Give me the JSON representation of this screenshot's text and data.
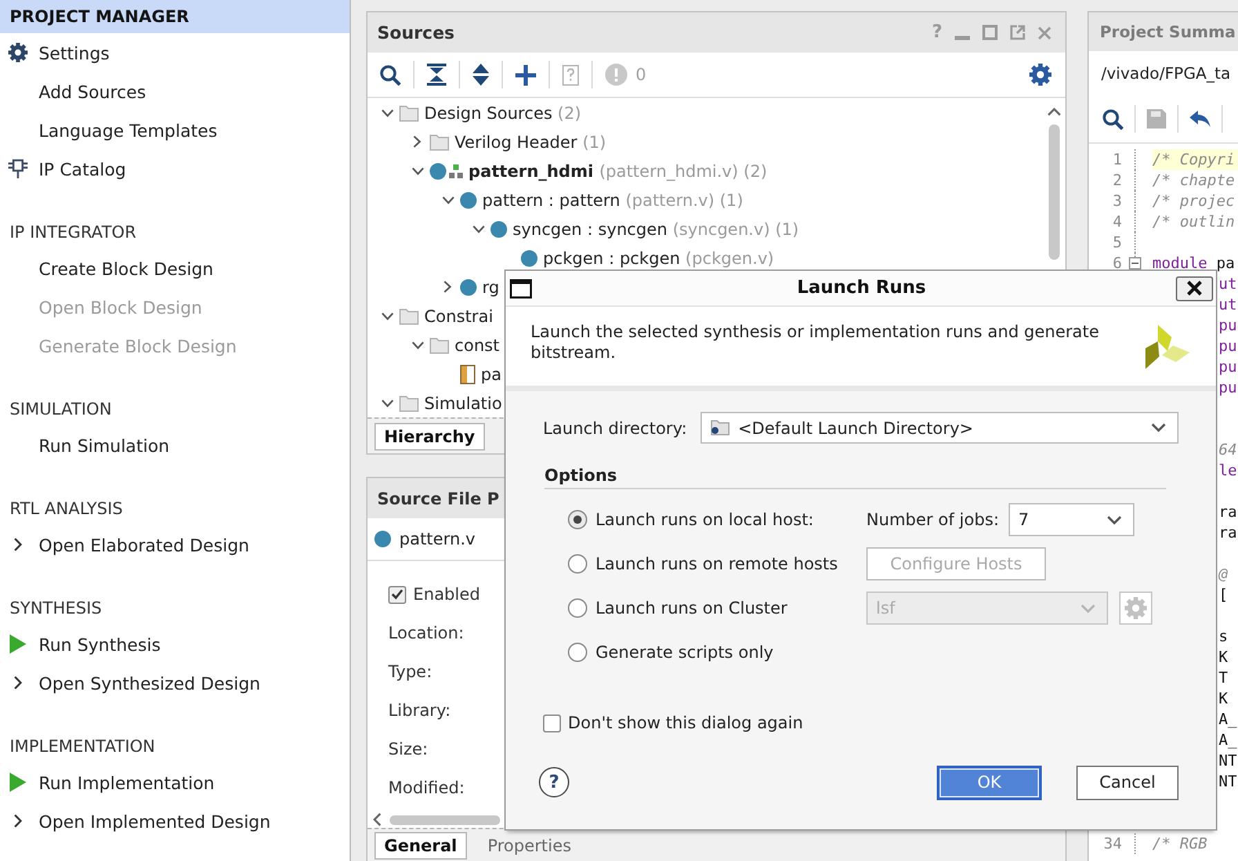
{
  "flow_navigator": {
    "sections": [
      {
        "title": "PROJECT MANAGER",
        "selected": true,
        "items": [
          {
            "label": "Settings",
            "kind": "gear",
            "disabled": false
          },
          {
            "label": "Add Sources",
            "kind": "plain",
            "disabled": false
          },
          {
            "label": "Language Templates",
            "kind": "plain",
            "disabled": false
          },
          {
            "label": "IP Catalog",
            "kind": "chip",
            "disabled": false
          }
        ]
      },
      {
        "title": "IP INTEGRATOR",
        "selected": false,
        "items": [
          {
            "label": "Create Block Design",
            "kind": "plain",
            "disabled": false
          },
          {
            "label": "Open Block Design",
            "kind": "plain",
            "disabled": true
          },
          {
            "label": "Generate Block Design",
            "kind": "plain",
            "disabled": true
          }
        ]
      },
      {
        "title": "SIMULATION",
        "selected": false,
        "items": [
          {
            "label": "Run Simulation",
            "kind": "plain",
            "disabled": false
          }
        ]
      },
      {
        "title": "RTL ANALYSIS",
        "selected": false,
        "items": [
          {
            "label": "Open Elaborated Design",
            "kind": "expand",
            "disabled": false
          }
        ]
      },
      {
        "title": "SYNTHESIS",
        "selected": false,
        "items": [
          {
            "label": "Run Synthesis",
            "kind": "run",
            "disabled": false
          },
          {
            "label": "Open Synthesized Design",
            "kind": "expand",
            "disabled": false
          }
        ]
      },
      {
        "title": "IMPLEMENTATION",
        "selected": false,
        "items": [
          {
            "label": "Run Implementation",
            "kind": "run",
            "disabled": false
          },
          {
            "label": "Open Implemented Design",
            "kind": "expand",
            "disabled": false
          }
        ]
      }
    ]
  },
  "sources": {
    "title": "Sources",
    "help": "?",
    "message_count": "0",
    "tree": [
      {
        "label": "Design Sources",
        "detail": "(2)",
        "kind": "folder",
        "expanded": true,
        "children": [
          {
            "label": "Verilog Header",
            "detail": "(1)",
            "kind": "folder",
            "expanded": false
          },
          {
            "label": "pattern_hdmi",
            "detail": "(pattern_hdmi.v) (2)",
            "kind": "top_module",
            "expanded": true,
            "children": [
              {
                "label": "pattern : pattern",
                "detail": "(pattern.v) (1)",
                "kind": "module",
                "expanded": true,
                "children": [
                  {
                    "label": "syncgen : syncgen",
                    "detail": "(syncgen.v) (1)",
                    "kind": "module",
                    "expanded": true,
                    "children": [
                      {
                        "label": "pckgen : pckgen",
                        "detail": "(pckgen.v)",
                        "kind": "module"
                      }
                    ]
                  }
                ]
              },
              {
                "label": "rg",
                "kind": "module",
                "expanded": false
              }
            ]
          }
        ]
      },
      {
        "label": "Constrai",
        "kind": "folder",
        "expanded": true,
        "children": [
          {
            "label": "const",
            "kind": "folder",
            "expanded": true,
            "children": [
              {
                "label": "pa",
                "kind": "constraint_file"
              }
            ]
          }
        ]
      },
      {
        "label": "Simulatio",
        "kind": "folder",
        "expanded": true
      }
    ],
    "tabs": [
      {
        "label": "Hierarchy",
        "selected": true
      }
    ]
  },
  "source_file_properties": {
    "title": "Source File P",
    "file": "pattern.v",
    "enabled": {
      "label": "Enabled",
      "checked": true
    },
    "fields": [
      "Location:",
      "Type:",
      "Library:",
      "Size:",
      "Modified:"
    ],
    "tabs": [
      {
        "label": "General",
        "selected": true
      },
      {
        "label": "Properties",
        "selected": false
      }
    ]
  },
  "project_summary": {
    "title": "Project Summa",
    "path": "/vivado/FPGA_ta",
    "lines": [
      {
        "kind": "numbered",
        "number": "1",
        "current": true,
        "fold": false,
        "code": [
          {
            "text": "/* Copyri",
            "kind": "comment"
          }
        ]
      },
      {
        "kind": "numbered",
        "number": "2",
        "current": false,
        "fold": false,
        "code": [
          {
            "text": "/* chapte",
            "kind": "comment"
          }
        ]
      },
      {
        "kind": "numbered",
        "number": "3",
        "current": false,
        "fold": false,
        "code": [
          {
            "text": "/* projec",
            "kind": "comment"
          }
        ]
      },
      {
        "kind": "numbered",
        "number": "4",
        "current": false,
        "fold": false,
        "code": [
          {
            "text": "/* outlin",
            "kind": "comment"
          }
        ]
      },
      {
        "kind": "numbered",
        "number": "5",
        "current": false,
        "fold": false
      },
      {
        "kind": "numbered",
        "number": "6",
        "current": false,
        "fold": true,
        "code": [
          {
            "text": "module",
            "kind": "keyword"
          },
          {
            "text": "pa",
            "kind": "plain"
          }
        ]
      },
      {
        "kind": "tail",
        "code": [
          {
            "text": "ut",
            "kind": "keyword"
          }
        ]
      },
      {
        "kind": "tail",
        "code": [
          {
            "text": "ut",
            "kind": "keyword"
          }
        ]
      },
      {
        "kind": "tail",
        "code": [
          {
            "text": "pu",
            "kind": "keyword"
          }
        ]
      },
      {
        "kind": "tail",
        "code": [
          {
            "text": "pu",
            "kind": "keyword"
          }
        ]
      },
      {
        "kind": "tail",
        "code": [
          {
            "text": "pu",
            "kind": "keyword"
          }
        ]
      },
      {
        "kind": "tail",
        "code": [
          {
            "text": "pu",
            "kind": "keyword"
          }
        ]
      },
      {
        "kind": "blank"
      },
      {
        "kind": "blank"
      },
      {
        "kind": "tail",
        "code": [
          {
            "text": "64",
            "kind": "comment"
          }
        ]
      },
      {
        "kind": "tail",
        "code": [
          {
            "text": "le",
            "kind": "keyword"
          }
        ]
      },
      {
        "kind": "blank"
      },
      {
        "kind": "tail",
        "code": [
          {
            "text": "ra",
            "kind": "plain"
          }
        ]
      },
      {
        "kind": "tail",
        "code": [
          {
            "text": "ra",
            "kind": "plain"
          }
        ]
      },
      {
        "kind": "blank"
      },
      {
        "kind": "tail",
        "code": [
          {
            "text": "@",
            "kind": "comment"
          }
        ]
      },
      {
        "kind": "tail",
        "code": [
          {
            "text": "[",
            "kind": "plain"
          }
        ]
      },
      {
        "kind": "blank"
      },
      {
        "kind": "tail",
        "code": [
          {
            "text": "s",
            "kind": "plain"
          }
        ]
      },
      {
        "kind": "tail",
        "code": [
          {
            "text": "K",
            "kind": "plain"
          }
        ]
      },
      {
        "kind": "tail",
        "code": [
          {
            "text": "T",
            "kind": "plain"
          }
        ]
      },
      {
        "kind": "tail",
        "code": [
          {
            "text": "K",
            "kind": "plain"
          }
        ]
      },
      {
        "kind": "tail",
        "code": [
          {
            "text": "A_",
            "kind": "plain"
          }
        ]
      },
      {
        "kind": "tail",
        "code": [
          {
            "text": "A_",
            "kind": "plain"
          }
        ]
      },
      {
        "kind": "tail",
        "code": [
          {
            "text": "NT",
            "kind": "plain"
          }
        ]
      },
      {
        "kind": "tail",
        "code": [
          {
            "text": "NT",
            "kind": "plain"
          }
        ]
      },
      {
        "kind": "blank"
      },
      {
        "kind": "blank"
      },
      {
        "kind": "numbered",
        "number": "34",
        "current": false,
        "fold": false,
        "code": [
          {
            "text": "/* RGB",
            "kind": "comment"
          }
        ]
      }
    ]
  },
  "dialog": {
    "title": "Launch Runs",
    "description": "Launch the selected synthesis or implementation runs and generate bitstream.",
    "launch_directory": {
      "label": "Launch directory:",
      "value": "<Default Launch Directory>"
    },
    "options": {
      "title": "Options",
      "choices": [
        {
          "kind": "jobs",
          "label": "Launch runs on local host:",
          "selected": true,
          "jobs": {
            "label": "Number of jobs:",
            "value": "7"
          }
        },
        {
          "kind": "hosts",
          "label": "Launch runs on remote hosts",
          "selected": false,
          "button": {
            "label": "Configure Hosts",
            "disabled": true
          }
        },
        {
          "kind": "cluster",
          "label": "Launch runs on Cluster",
          "selected": false,
          "cluster": {
            "value": "lsf",
            "disabled": true
          }
        },
        {
          "kind": "plain",
          "label": "Generate scripts only",
          "selected": false
        }
      ]
    },
    "dont_show": {
      "label": "Don't show this dialog again",
      "checked": false
    },
    "help": "?",
    "buttons": [
      {
        "label": "OK",
        "kind": "primary"
      },
      {
        "label": "Cancel",
        "kind": "secondary"
      }
    ]
  }
}
